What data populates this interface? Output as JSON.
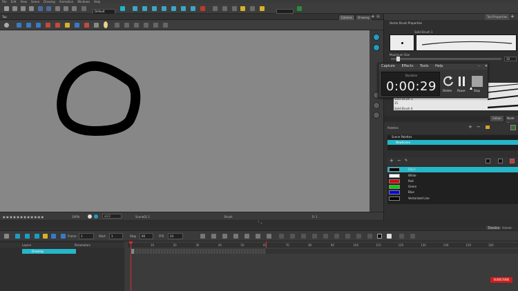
{
  "menubar": {
    "items": [
      "File",
      "Edit",
      "View",
      "Scene",
      "Drawing",
      "Animation",
      "Windows",
      "Help"
    ]
  },
  "toolbar": {
    "preset_value": "Default"
  },
  "view_tabs": {
    "camera": "Camera",
    "drawing": "Drawing",
    "top_left_label": "Top",
    "tool_properties": "Tool Properties"
  },
  "tool_properties": {
    "title": "Vector Brush Properties",
    "preset_label": "Solid Brush 1",
    "max_size_label": "Maximum Size",
    "max_size_value": "30",
    "brush_list": [
      {
        "name": "Solid Brush 3",
        "size": "15"
      },
      {
        "name": "Solid Brush 4",
        "size": ""
      }
    ]
  },
  "recorder": {
    "menu": [
      "Capture",
      "Effects",
      "Tools",
      "Help"
    ],
    "duration_label": "Duration",
    "time": "0:00:29",
    "delete_label": "Delete",
    "pause_label": "Pause",
    "stop_label": "Stop"
  },
  "colour_panel": {
    "tab_colour": "Colour",
    "tab_node": "Node Sl",
    "palettes_label": "Palettes",
    "scene_palettes": "Scene Palettes",
    "palette_name": "NewScene",
    "swatches": [
      {
        "name": "Black",
        "color": "#000000"
      },
      {
        "name": "White",
        "color": "#ffffff"
      },
      {
        "name": "Red",
        "color": "#e00000"
      },
      {
        "name": "Green",
        "color": "#00d000"
      },
      {
        "name": "Blue",
        "color": "#0000e0"
      },
      {
        "name": "Vectorized Line",
        "color": "#000000"
      }
    ]
  },
  "camera_status": {
    "zoom": "100%",
    "overlay": "a4,0",
    "frame_info": "Scene01 1",
    "tool": "Brush",
    "fr": "Fr 1"
  },
  "timeline": {
    "frame_label": "Frame",
    "frame_value": "1",
    "start_label": "Start",
    "start_value": "1",
    "stop_label": "Stop",
    "stop_value": "60",
    "fps_label": "FPS",
    "fps_value": "24",
    "tab_timeline": "Timeline",
    "tab_xsheet": "Xsheet",
    "layers_header": "Layers",
    "parameters_header": "Parameters",
    "layer_name": "Drawing",
    "ruler_ticks": [
      "10",
      "20",
      "30",
      "40",
      "50",
      "60",
      "70",
      "80",
      "90",
      "100",
      "110",
      "120",
      "130",
      "140",
      "150",
      "160"
    ]
  },
  "watermark": "SUBSCRIBE"
}
